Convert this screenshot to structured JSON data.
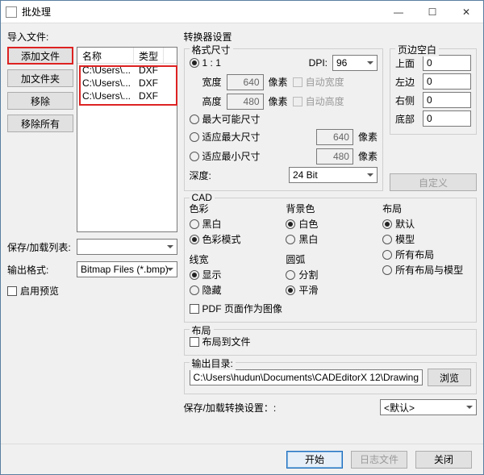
{
  "window": {
    "title": "批处理"
  },
  "left": {
    "import_label": "导入文件:",
    "add_file": "添加文件",
    "add_folder": "加文件夹",
    "remove": "移除",
    "remove_all": "移除所有",
    "col_name": "名称",
    "col_type": "类型",
    "rows": [
      {
        "name": "C:\\Users\\...",
        "type": "DXF"
      },
      {
        "name": "C:\\Users\\...",
        "type": "DXF"
      },
      {
        "name": "C:\\Users\\...",
        "type": "DXF"
      }
    ],
    "save_load_list": "保存/加载列表:",
    "save_load_value": "",
    "output_format": "输出格式:",
    "output_format_value": "Bitmap Files (*.bmp)",
    "enable_preview": "启用预览"
  },
  "conv": {
    "title": "转换器设置",
    "fmt_title": "格式尺寸",
    "r_1_1": "1 : 1",
    "dpi_label": "DPI:",
    "dpi_value": "96",
    "width_label": "宽度",
    "width_value": "640",
    "px1": "像素",
    "auto_w": "自动宽度",
    "height_label": "高度",
    "height_value": "480",
    "px2": "像素",
    "auto_h": "自动高度",
    "r_max": "最大可能尺寸",
    "r_fit_max": "适应最大尺寸",
    "fit_max_v": "640",
    "px3": "像素",
    "r_fit_min": "适应最小尺寸",
    "fit_min_v": "480",
    "px4": "像素",
    "depth_label": "深度:",
    "depth_value": "24 Bit",
    "margin_title": "页边空白",
    "m_top": "上面",
    "m_top_v": "0",
    "m_left": "左边",
    "m_left_v": "0",
    "m_right": "右侧",
    "m_right_v": "0",
    "m_bottom": "底部",
    "m_bottom_v": "0",
    "custom": "自定义",
    "cad_title": "CAD",
    "g_color": "色彩",
    "c_bw": "黑白",
    "c_color": "色彩模式",
    "g_bg": "背景色",
    "b_white": "白色",
    "b_black": "黑白",
    "g_line": "线宽",
    "l_show": "显示",
    "l_hide": "隐藏",
    "g_arc": "圆弧",
    "a_split": "分割",
    "a_smooth": "平滑",
    "g_layout": "布局",
    "ly_def": "默认",
    "ly_model": "模型",
    "ly_all": "所有布局",
    "ly_allm": "所有布局与模型",
    "pdf_chk": "PDF 页面作为图像",
    "lay2_title": "布局",
    "lay2_chk": "布局到文件",
    "out_dir_label": "输出目录:",
    "out_dir_value": "C:\\Users\\hudun\\Documents\\CADEditorX 12\\Drawing",
    "browse": "浏览",
    "save_conv": "保存/加载转换设置：:",
    "save_conv_value": "<默认>"
  },
  "footer": {
    "start": "开始",
    "log": "日志文件",
    "close": "关闭"
  }
}
